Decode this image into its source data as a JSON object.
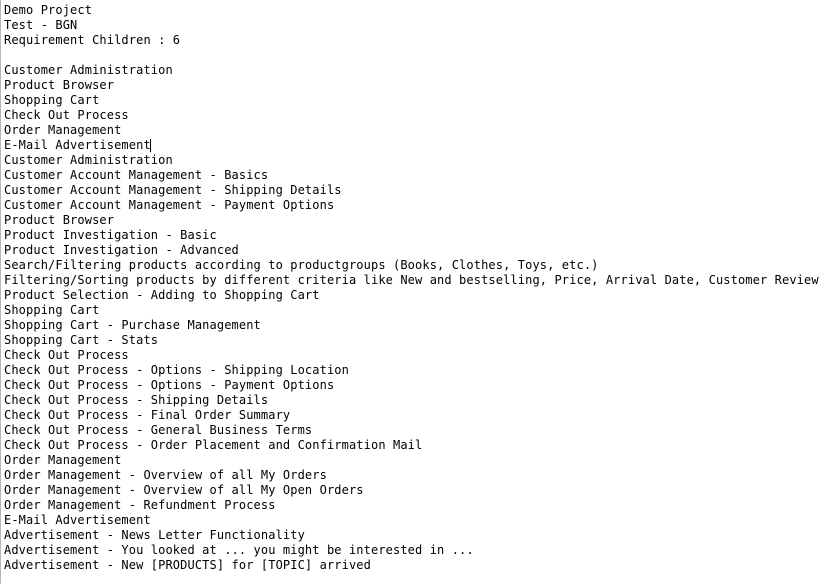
{
  "panel": {
    "background_color": "#ffffff",
    "text_color": "#000000",
    "border_color": "#b7b7b7",
    "caret_color": "#000000",
    "caret_line_index": 9
  },
  "header": {
    "project": "Demo Project",
    "test": "Test - BGN",
    "count_label": "Requirement Children : 6"
  },
  "lines": [
    "Demo Project",
    "Test - BGN",
    "Requirement Children : 6",
    "",
    "Customer Administration",
    "Product Browser",
    "Shopping Cart",
    "Check Out Process",
    "Order Management",
    "E-Mail Advertisement",
    "Customer Administration",
    "Customer Account Management - Basics",
    "Customer Account Management - Shipping Details",
    "Customer Account Management - Payment Options",
    "Product Browser",
    "Product Investigation - Basic",
    "Product Investigation - Advanced",
    "Search/Filtering products according to productgroups (Books, Clothes, Toys, etc.)",
    "Filtering/Sorting products by different criteria like New and bestselling, Price, Arrival Date, Customer Review",
    "Product Selection - Adding to Shopping Cart",
    "Shopping Cart",
    "Shopping Cart - Purchase Management",
    "Shopping Cart - Stats",
    "Check Out Process",
    "Check Out Process - Options - Shipping Location",
    "Check Out Process - Options - Payment Options",
    "Check Out Process - Shipping Details",
    "Check Out Process - Final Order Summary",
    "Check Out Process - General Business Terms",
    "Check Out Process - Order Placement and Confirmation Mail",
    "Order Management",
    "Order Management - Overview of all My Orders",
    "Order Management - Overview of all My Open Orders",
    "Order Management - Refundment Process",
    "E-Mail Advertisement",
    "Advertisement - News Letter Functionality",
    "Advertisement - You looked at ... you might be interested in ...",
    "Advertisement - New [PRODUCTS] for [TOPIC] arrived"
  ]
}
